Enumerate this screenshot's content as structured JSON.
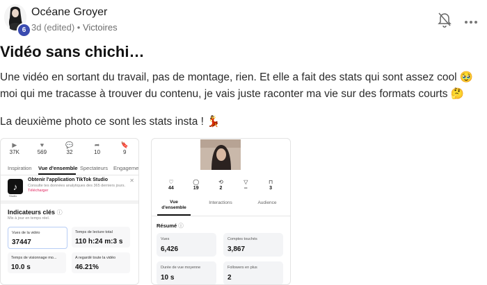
{
  "post": {
    "author": "Océane Groyer",
    "level": "6",
    "time": "3d (edited)",
    "separator": "•",
    "space": "Victoires",
    "title": "Vidéo sans chichi…",
    "paragraph1": "Une vidéo en sortant du travail, pas de montage, rien. Et elle a fait des stats qui sont assez cool 🥹 moi qui me tracasse à trouver du contenu, je vais juste raconter ma vie sur des formats courts 🤔",
    "paragraph2": "La deuxième photo ce sont les stats insta ! 💃"
  },
  "icons": {
    "bell": "bell-off-icon",
    "more": "more-horizontal-icon",
    "accent": "#3a4bb0"
  },
  "tiktok": {
    "stats": [
      {
        "icon": "▶",
        "value": "37K"
      },
      {
        "icon": "♥",
        "value": "569"
      },
      {
        "icon": "💬",
        "value": "32"
      },
      {
        "icon": "➦",
        "value": "10"
      },
      {
        "icon": "🔖",
        "value": "9"
      }
    ],
    "tabs": [
      "Inspiration",
      "Vue d'ensemble",
      "Spectateurs",
      "Engageme"
    ],
    "active_tab": "Vue d'ensemble",
    "banner": {
      "logo_sub": "Studio",
      "title": "Obtenir l'application TikTok Studio",
      "desc": "Consulte tes données analytiques des 365 derniers jours.",
      "link": "Télécharger",
      "close": "✕"
    },
    "indicators": {
      "title": "Indicateurs clés",
      "info": "ⓘ",
      "subtitle": "Mis à jour en temps réel."
    },
    "metrics": [
      {
        "label": "Vues de la vidéo",
        "value": "37447"
      },
      {
        "label": "Temps de lecture total",
        "value": "110 h:24 m:3 s"
      },
      {
        "label": "Temps de visionnage mo...",
        "value": "10.0 s"
      },
      {
        "label": "A regardé toute la vidéo",
        "value": "46.21%"
      }
    ]
  },
  "instagram": {
    "icons": [
      {
        "icon": "♡",
        "value": "44"
      },
      {
        "icon": "◯",
        "value": "19"
      },
      {
        "icon": "⟲",
        "value": "2"
      },
      {
        "icon": "▽",
        "value": "--"
      },
      {
        "icon": "⊓",
        "value": "3"
      }
    ],
    "tabs": [
      "Vue d'ensemble",
      "Interactions",
      "Audience"
    ],
    "resume_title": "Résumé",
    "resume_info": "ⓘ",
    "metrics": [
      {
        "label": "Vues",
        "value": "6,426"
      },
      {
        "label": "Comptes touchés",
        "value": "3,867"
      },
      {
        "label": "Durée de vue moyenne",
        "value": "10 s"
      },
      {
        "label": "Followers en plus",
        "value": "2"
      }
    ]
  }
}
